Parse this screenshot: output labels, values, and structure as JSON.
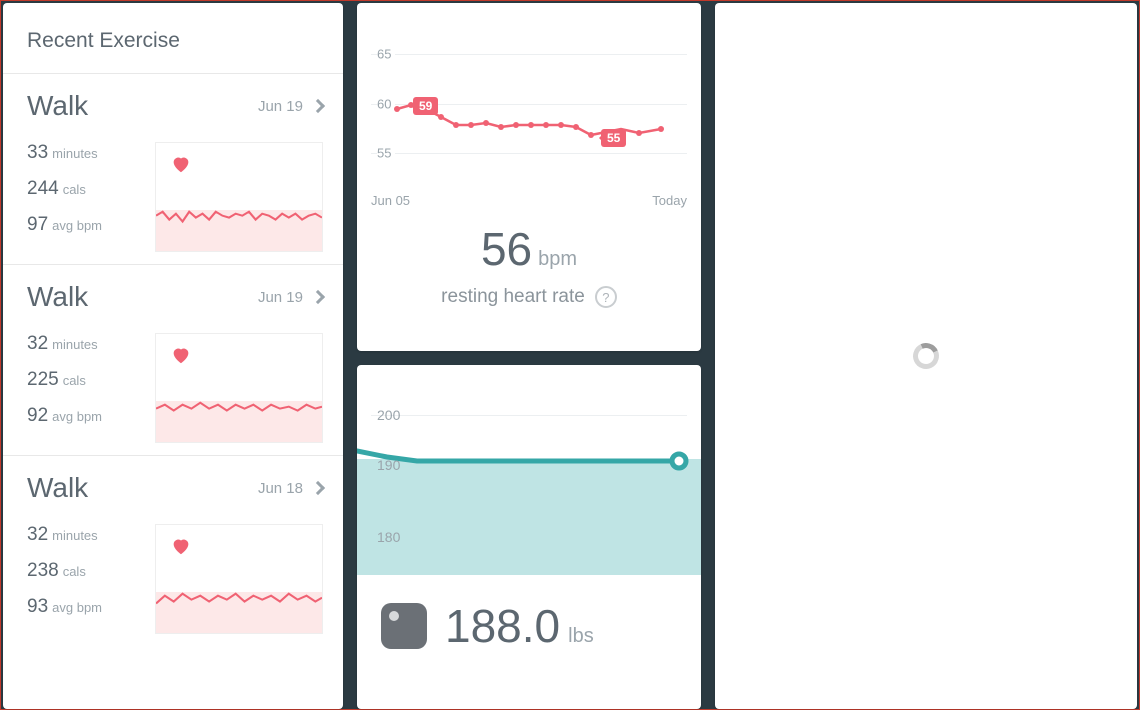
{
  "recent_exercise": {
    "title": "Recent Exercise",
    "items": [
      {
        "type": "Walk",
        "date": "Jun 19",
        "minutes": "33",
        "minutes_unit": "minutes",
        "cals": "244",
        "cals_unit": "cals",
        "bpm": "97",
        "bpm_unit": "avg bpm"
      },
      {
        "type": "Walk",
        "date": "Jun 19",
        "minutes": "32",
        "minutes_unit": "minutes",
        "cals": "225",
        "cals_unit": "cals",
        "bpm": "92",
        "bpm_unit": "avg bpm"
      },
      {
        "type": "Walk",
        "date": "Jun 18",
        "minutes": "32",
        "minutes_unit": "minutes",
        "cals": "238",
        "cals_unit": "cals",
        "bpm": "93",
        "bpm_unit": "avg bpm"
      }
    ]
  },
  "heart_rate": {
    "value": "56",
    "unit": "bpm",
    "subtitle": "resting heart rate",
    "x_start": "Jun 05",
    "x_end": "Today",
    "y_ticks": [
      "65",
      "60",
      "55"
    ],
    "callouts": {
      "start": "59",
      "end": "55"
    }
  },
  "weight": {
    "value": "188.0",
    "unit": "lbs",
    "y_ticks": [
      "200",
      "190",
      "180"
    ]
  },
  "chart_data": [
    {
      "type": "line",
      "title": "resting heart rate",
      "ylabel": "bpm",
      "ylim": [
        52,
        66
      ],
      "x_start": "Jun 05",
      "x_end": "Today",
      "series": [
        {
          "name": "resting HR",
          "values": [
            59,
            60,
            59,
            58,
            57,
            57,
            57.5,
            57,
            57,
            57,
            57,
            57,
            56.5,
            55,
            56,
            55.5,
            56
          ]
        }
      ],
      "annotations": [
        {
          "label": "59",
          "index": 0
        },
        {
          "label": "55",
          "index": 13
        }
      ]
    },
    {
      "type": "area",
      "title": "weight",
      "ylabel": "lbs",
      "ylim": [
        175,
        205
      ],
      "series": [
        {
          "name": "weight",
          "values": [
            192,
            191,
            190,
            190,
            190,
            190,
            190,
            190,
            190,
            190,
            190,
            190,
            190,
            190,
            190,
            190,
            190
          ]
        }
      ]
    }
  ]
}
